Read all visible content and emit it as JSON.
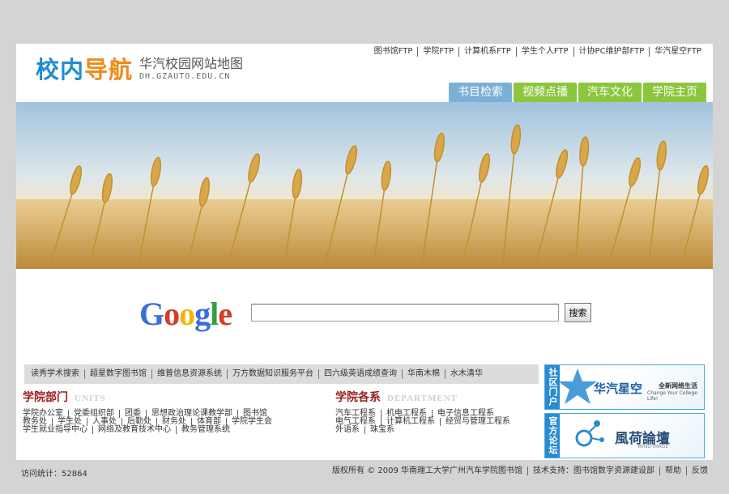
{
  "header": {
    "logo_main_a": "校内",
    "logo_main_b": "导航",
    "logo_sub_title": "华汽校园网站地图",
    "logo_sub_url": "DH.GZAUTO.EDU.CN",
    "ftp_links": [
      "图书馆FTP",
      "学院FTP",
      "计算机系FTP",
      "学生个人FTP",
      "计协PC维护部FTP",
      "华汽星空FTP"
    ],
    "tabs": [
      "书目检索",
      "视频点播",
      "汽车文化",
      "学院主页"
    ],
    "active_tab": 0
  },
  "search": {
    "logo_text": "Google",
    "input_value": "",
    "button_label": "搜索"
  },
  "quick_links": [
    "读秀学术搜索",
    "超星数字图书馆",
    "维普信息资源系统",
    "万方数据知识服务平台",
    "四六级英语成绩查询",
    "华南木棉",
    "水木清华"
  ],
  "departments": {
    "title": "学院部门",
    "title_en": "UNITS",
    "rows": [
      [
        "学院办公室",
        "党委组织部",
        "团委",
        "思想政治理论课教学部",
        "图书馆"
      ],
      [
        "教务处",
        "学生处",
        "人事处",
        "后勤处",
        "财务处",
        "体育部",
        "学院学生会"
      ],
      [
        "学生就业指导中心",
        "网络及教育技术中心",
        "教务管理系统"
      ]
    ]
  },
  "faculties": {
    "title": "学院各系",
    "title_en": "DEPARTMENT",
    "rows": [
      [
        "汽车工程系",
        "机电工程系",
        "电子信息工程系"
      ],
      [
        "电气工程系",
        "计算机工程系",
        "经贸与管理工程系"
      ],
      [
        "外语系",
        "珠宝系"
      ]
    ]
  },
  "portals": [
    {
      "side": "社区门户",
      "name": "华汽星空",
      "tagline": "全新网络生活",
      "tagline_en": "Change Your College Life!"
    },
    {
      "side": "官方论坛",
      "name": "風荷論壇",
      "tagline_en": "WIND·IMAGE"
    }
  ],
  "footer": {
    "visits": "访问统计：52864",
    "copyright": "版权所有 © 2009 华南理工大学广州汽车学院图书馆",
    "tech": "技术支持：图书馆数字资源建设部",
    "help": "帮助",
    "feedback": "反馈"
  },
  "colors": {
    "logo_blue": "#1f8ed1",
    "logo_orange": "#f08a1c",
    "tab_green": "#8cc63f",
    "tab_active": "#7bb0d6",
    "section_red": "#9b1c1c"
  }
}
